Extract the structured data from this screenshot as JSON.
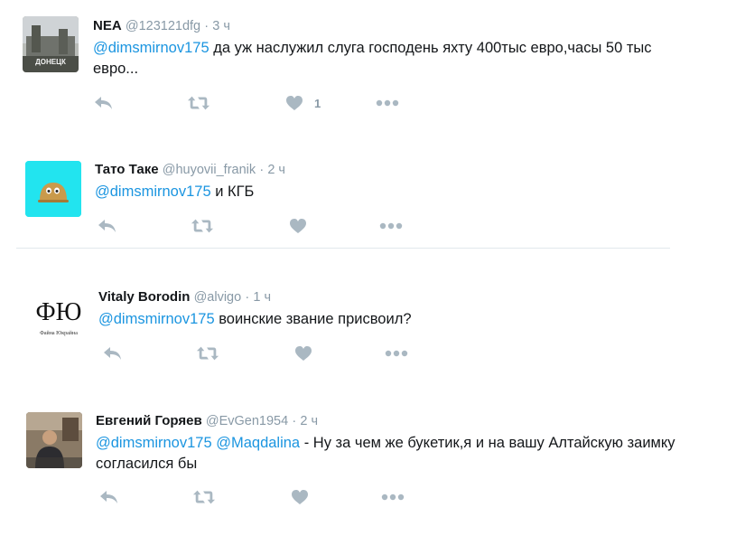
{
  "colors": {
    "mention": "#1b95e0",
    "muted": "#8899a6",
    "icon": "#aab8c2",
    "divider": "#e1e8ed"
  },
  "tweets": [
    {
      "name": "NEA",
      "handle": "@123121dfg",
      "sep": "·",
      "time": "3 ч",
      "mentions": [
        "@dimsmirnov175"
      ],
      "text": " да уж наслужил слуга господень яхту 400тыс евро,часы 50 тыс евро...",
      "like_count": "1",
      "avatar_text": "ДОНЕЦК"
    },
    {
      "name": "Тато Таке",
      "handle": "@huyovii_franik",
      "sep": "·",
      "time": "2 ч",
      "mentions": [
        "@dimsmirnov175"
      ],
      "text": " и КГБ",
      "like_count": ""
    },
    {
      "name": "Vitaly Borodin",
      "handle": "@alvigo",
      "sep": "·",
      "time": "1 ч",
      "mentions": [
        "@dimsmirnov175"
      ],
      "text": " воинские звание присвоил?",
      "like_count": "",
      "avatar_text": "ФЮ",
      "avatar_subtext": "Файна Юкрайна"
    },
    {
      "name": "Евгений Горяев",
      "handle": "@EvGen1954",
      "sep": "·",
      "time": "2 ч",
      "mentions": [
        "@dimsmirnov175",
        "@Maqdalina"
      ],
      "text": " - Ну за чем же букетик,я и на вашу Алтайскую заимку согласился бы",
      "like_count": ""
    }
  ],
  "icons": [
    "reply-icon",
    "retweet-icon",
    "like-icon",
    "more-icon"
  ]
}
